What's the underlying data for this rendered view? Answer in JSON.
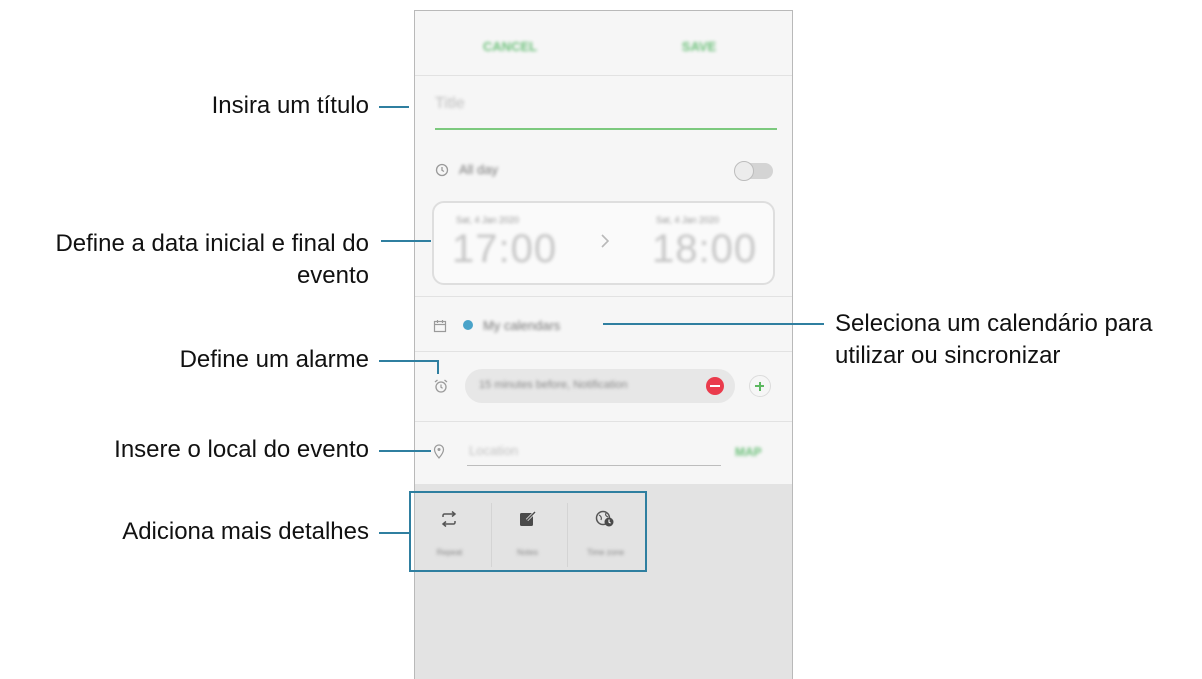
{
  "callouts": {
    "title": "Insira um título",
    "date_line1": "Define a data inicial e final do",
    "date_line2": "evento",
    "calendar_line1": "Seleciona um calendário para",
    "calendar_line2": "utilizar ou sincronizar",
    "alarm": "Define um alarme",
    "location": "Insere o local do evento",
    "details": "Adiciona mais detalhes"
  },
  "phone": {
    "cancel_label": "CANCEL",
    "save_label": "SAVE",
    "title_placeholder": "Title",
    "allday_label": "All day",
    "start_small": "Sat, 4 Jan 2020",
    "start_time": "17:00",
    "end_small": "Sat, 4 Jan 2020",
    "end_time": "18:00",
    "calendar_name": "My calendars",
    "alarm_value": "15 minutes before, Notification",
    "location_placeholder": "Location",
    "map_label": "MAP",
    "details": [
      {
        "label": "Repeat",
        "icon": "repeat-icon"
      },
      {
        "label": "Notes",
        "icon": "notes-icon"
      },
      {
        "label": "Time zone",
        "icon": "timezone-icon"
      }
    ]
  },
  "colors": {
    "accent_green": "#7cc97e",
    "callout_line": "#2f7fa0",
    "calendar_dot": "#4aa3c9"
  }
}
